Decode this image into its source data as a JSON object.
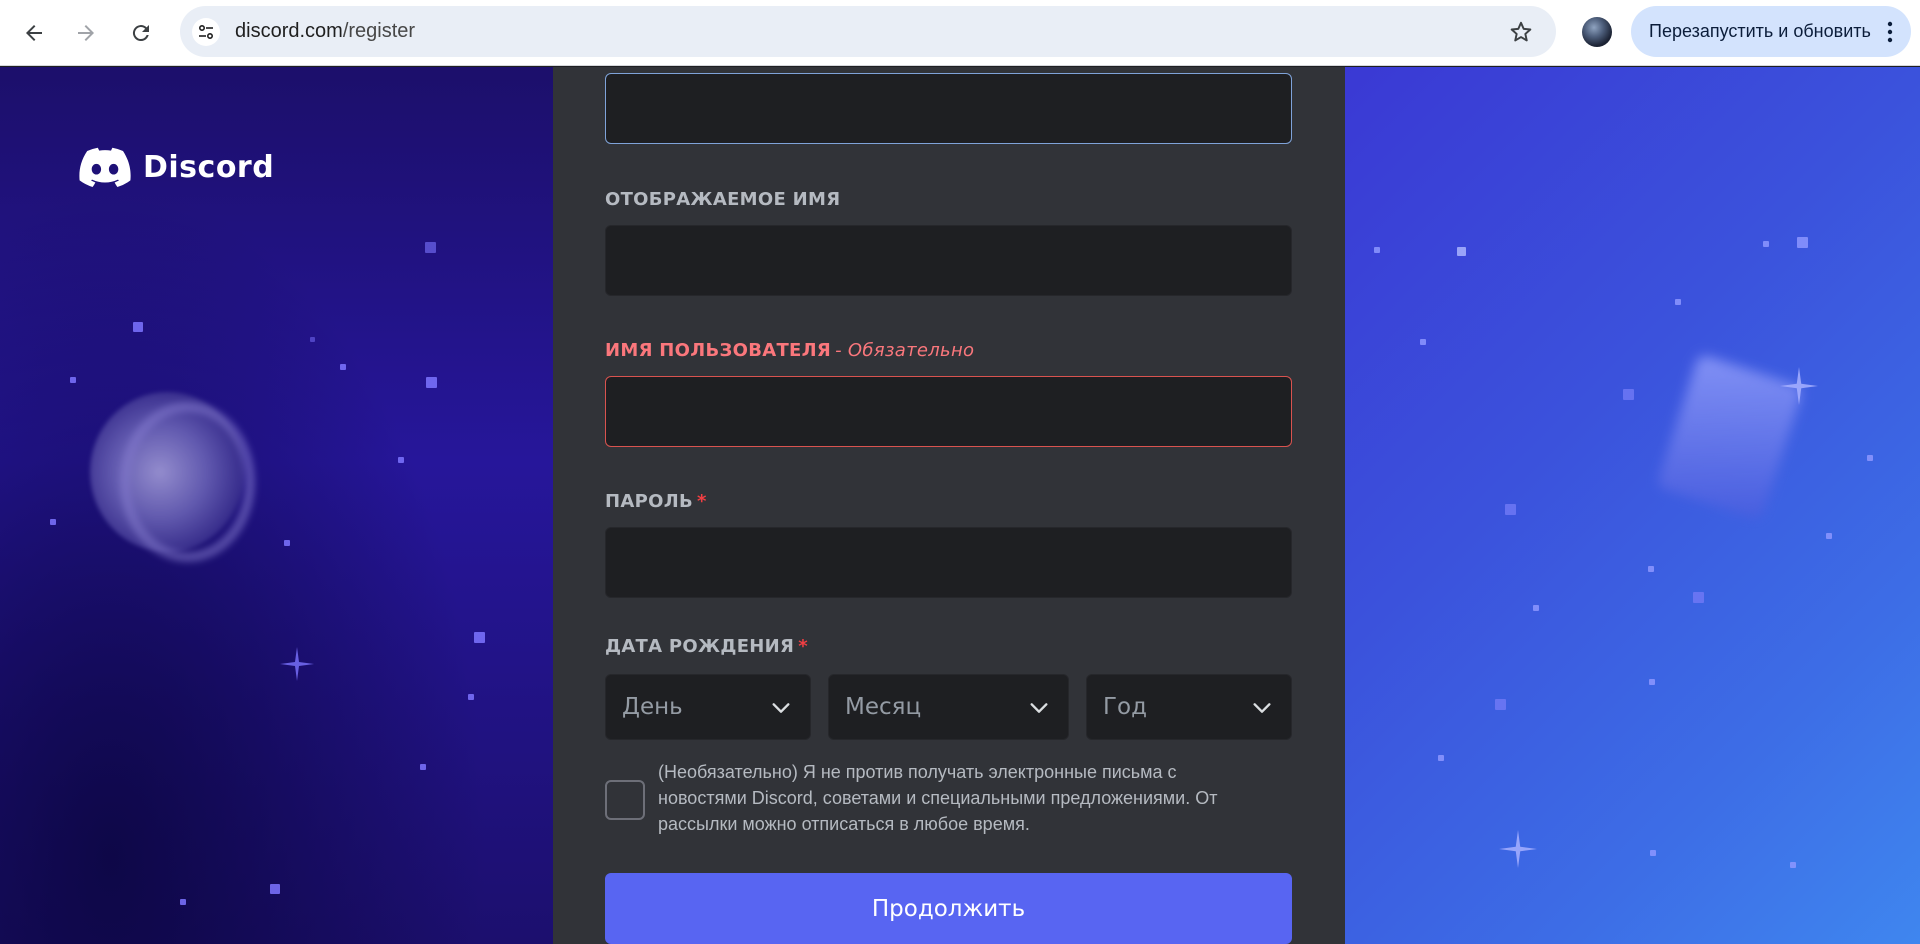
{
  "browser": {
    "url_domain": "discord.com",
    "url_path": "/register",
    "relaunch_label": "Перезапустить и обновить"
  },
  "brand": {
    "name": "Discord"
  },
  "form": {
    "display_name_label": "ОТОБРАЖАЕМОЕ ИМЯ",
    "username_label": "ИМЯ ПОЛЬЗОВАТЕЛЯ",
    "username_error": "- Обязательно",
    "password_label": "ПАРОЛЬ",
    "required_marker": "*",
    "birthdate_label": "ДАТА РОЖДЕНИЯ",
    "day_placeholder": "День",
    "month_placeholder": "Месяц",
    "year_placeholder": "Год",
    "consent_text": "(Необязательно) Я не против получать электронные письма с новостями Discord, советами и специальными предложениями. От рассылки можно отписаться в любое время.",
    "continue_label": "Продолжить"
  },
  "colors": {
    "accent": "#5865f2",
    "error": "#fa777c",
    "panel": "#313338",
    "input": "#1e1f22"
  }
}
